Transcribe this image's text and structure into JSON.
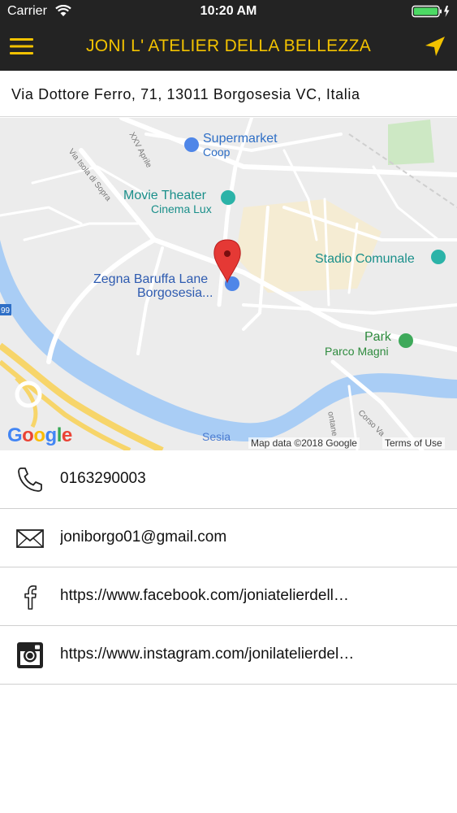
{
  "status_bar": {
    "carrier": "Carrier",
    "time": "10:20 AM"
  },
  "nav": {
    "title": "JONI L' ATELIER DELLA BELLEZZA",
    "accent_color": "#f2c200",
    "menu_icon": "hamburger-menu-icon",
    "locate_icon": "location-arrow-icon"
  },
  "address": "Via Dottore Ferro, 71, 13011 Borgosesia VC, Italia",
  "map": {
    "labels": {
      "supermarket_name": "Supermarket",
      "supermarket_sub": "Coop",
      "movie_name": "Movie Theater",
      "movie_sub": "Cinema Lux",
      "stadio": "Stadio Comunale",
      "zegna_name": "Zegna Baruffa Lane",
      "zegna_sub": "Borgosesia...",
      "park_name": "Park",
      "park_sub": "Parco Magni",
      "sesia": "Sesia",
      "road_xxv": "XXV Aprile",
      "road_isola": "Via Isola di Sopra",
      "road_corso": "Corso Va",
      "road_99": "99",
      "road_ontane": "ontane"
    },
    "google_logo": "Google",
    "attribution": "Map data ©2018 Google",
    "terms": "Terms of Use"
  },
  "contacts": {
    "phone": {
      "icon": "phone-icon",
      "text": "0163290003"
    },
    "email": {
      "icon": "envelope-icon",
      "text": "joniborgo01@gmail.com"
    },
    "facebook": {
      "icon": "facebook-icon",
      "text": "https://www.facebook.com/joniatelierdell…"
    },
    "instagram": {
      "icon": "instagram-icon",
      "text": "https://www.instagram.com/jonilatelierdel…"
    }
  }
}
